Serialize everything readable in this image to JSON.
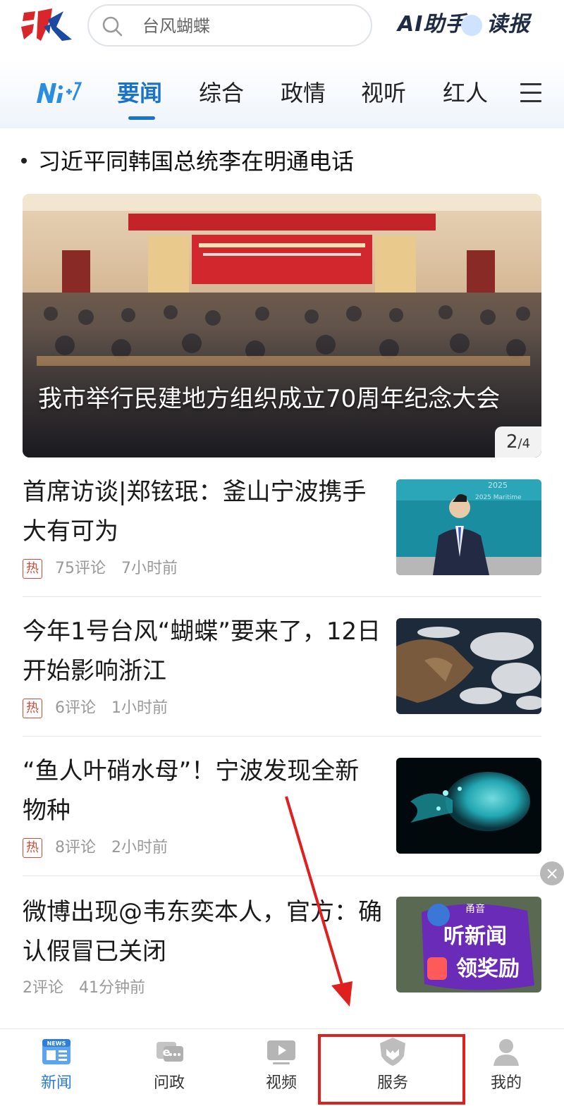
{
  "header": {
    "search_text": "台风蝴蝶",
    "ai_helper": "AI助手",
    "read_paper": "读报"
  },
  "tabs": [
    {
      "label": "要闻",
      "active": true
    },
    {
      "label": "综合",
      "active": false
    },
    {
      "label": "政情",
      "active": false
    },
    {
      "label": "视听",
      "active": false
    },
    {
      "label": "红人",
      "active": false
    }
  ],
  "headline": "习近平同韩国总统李在明通电话",
  "banner": {
    "caption": "我市举行民建地方组织成立70周年纪念大会",
    "page_current": "2",
    "page_total": "/4"
  },
  "news": [
    {
      "title": "首席访谈|郑铉珉：釜山宁波携手大有可为",
      "hot": "热",
      "comments": "75评论",
      "time": "7小时前"
    },
    {
      "title": "今年1号台风“蝴蝶”要来了，12日开始影响浙江",
      "hot": "热",
      "comments": "6评论",
      "time": "1小时前"
    },
    {
      "title": "“鱼人叶硝水母”！宁波发现全新物种",
      "hot": "热",
      "comments": "8评论",
      "time": "2小时前"
    },
    {
      "title": "微博出现@韦东奕本人，官方：确认假冒已关闭",
      "hot": "",
      "comments": "2评论",
      "time": "41分钟前"
    }
  ],
  "ad_thumb": {
    "line1": "甬音",
    "line2": "听新闻",
    "line3": "领奖励"
  },
  "close_float": "×",
  "bottom_nav": [
    {
      "label": "新闻",
      "icon": "news-icon",
      "active": true
    },
    {
      "label": "问政",
      "icon": "ask-gov-icon",
      "active": false
    },
    {
      "label": "视频",
      "icon": "video-icon",
      "active": false
    },
    {
      "label": "服务",
      "icon": "service-icon",
      "active": false
    },
    {
      "label": "我的",
      "icon": "profile-icon",
      "active": false
    }
  ],
  "colors": {
    "accent": "#1a73c9",
    "annotation": "#e01f1f",
    "hot": "#d04a3a"
  }
}
